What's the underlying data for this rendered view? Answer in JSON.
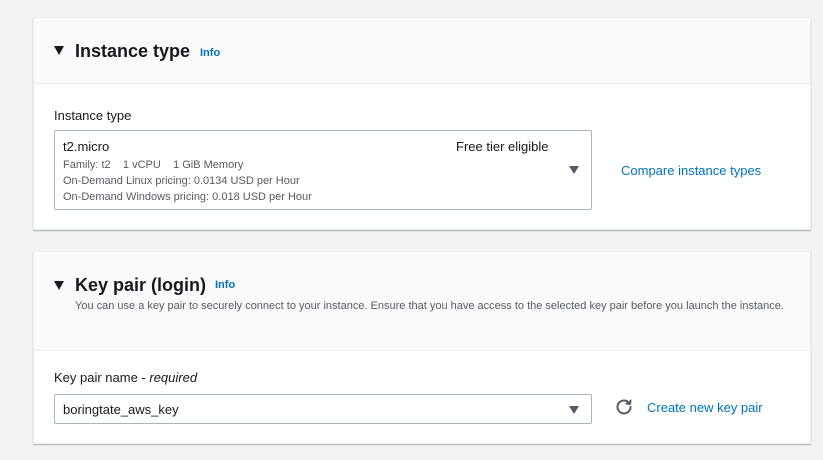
{
  "instance_section": {
    "title": "Instance type",
    "info": "Info",
    "field_label": "Instance type",
    "selected": {
      "name": "t2.micro",
      "tag": "Free tier eligible",
      "family": "Family: t2",
      "vcpu": "1 vCPU",
      "memory": "1 GiB Memory",
      "linux_pricing": "On-Demand Linux pricing: 0.0134 USD per Hour",
      "windows_pricing": "On-Demand Windows pricing: 0.018 USD per Hour"
    },
    "compare_link": "Compare instance types"
  },
  "keypair_section": {
    "title": "Key pair (login)",
    "info": "Info",
    "description": "You can use a key pair to securely connect to your instance. Ensure that you have access to the selected key pair before you launch the instance.",
    "field_label": "Key pair name - ",
    "field_required": "required",
    "selected": "boringtate_aws_key",
    "create_link": "Create new key pair"
  },
  "icons": {
    "collapse": "caret-down-icon",
    "dropdown": "dropdown-arrow-icon",
    "refresh": "refresh-icon"
  },
  "colors": {
    "link": "#0073bb",
    "text": "#16191f",
    "secondary_text": "#545b64",
    "border": "#aab7b8",
    "page_bg": "#f2f3f3"
  }
}
